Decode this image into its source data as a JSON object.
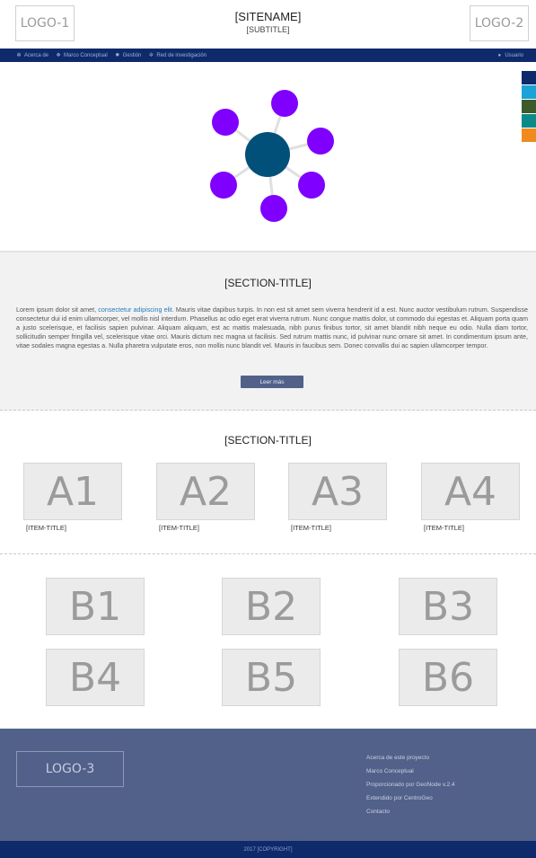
{
  "header": {
    "logo_left": "LOGO-1",
    "logo_right": "LOGO-2",
    "sitename": "[SITENAME]",
    "subtitle": "[SUBTITLE]"
  },
  "nav": {
    "items": [
      {
        "label": "Acerca de",
        "icon": "spinner-icon"
      },
      {
        "label": "Marco Conceptual",
        "icon": "cubes-icon"
      },
      {
        "label": "Gestión",
        "icon": "gear-icon"
      },
      {
        "label": "Red de investigación",
        "icon": "gears-icon"
      }
    ],
    "user": "Usuario",
    "background": "#0e2a6b"
  },
  "hero": {
    "center_color": "#00507a",
    "node_color": "#7f00ff",
    "swatches": [
      "#0e2a6b",
      "#1aa3d6",
      "#3d5a2a",
      "#0c8a8a",
      "#f08a1e"
    ]
  },
  "about": {
    "title": "[SECTION-TITLE]",
    "text_before_link": "Lorem ipsum dolor sit amet, ",
    "link": "consectetur adipiscing elit",
    "text_after_link": ". Mauris vitae dapibus turpis. In non est sit amet sem viverra hendrerit id a est. Nunc auctor vestibulum rutrum. Suspendisse consectetur dui id enim ullamcorper, vel mollis nisl interdum. Phasellus ac odio eget erat viverra rutrum. Nunc congue mattis dolor, ut commodo dui egestas et. Aliquam porta quam a justo scelerisque, et facilisis sapien pulvinar. Aliquam aliquam, est ac mattis malesuada, nibh purus finibus tortor, sit amet blandit nibh neque eu odio. Nulla diam tortor, sollicitudin semper fringilla vel, scelerisque vitae orci. Mauris dictum nec magna ut facilisis. Sed rutrum mattis nunc, id pulvinar nunc ornare sit amet. In condimentum ipsum ante, vitae sodales magna egestas a. Nulla pharetra vulputate eros, non mollis nunc blandit vel. Mauris in faucibus sem. Donec convallis dui ac sapien ullamcorper tempor.",
    "button": "Leer más"
  },
  "items_section": {
    "title": "[SECTION-TITLE]",
    "items": [
      {
        "tile": "A1",
        "title": "[ITEM-TITLE]"
      },
      {
        "tile": "A2",
        "title": "[ITEM-TITLE]"
      },
      {
        "tile": "A3",
        "title": "[ITEM-TITLE]"
      },
      {
        "tile": "A4",
        "title": "[ITEM-TITLE]"
      }
    ]
  },
  "grid_b": [
    "B1",
    "B2",
    "B3",
    "B4",
    "B5",
    "B6"
  ],
  "footer": {
    "logo": "LOGO-3",
    "links": [
      "Acerca de este proyecto",
      "Marco Conceptual",
      "Proporcionado por GeoNode v.2.4",
      "Extendido por CentroGeo",
      "Contacto"
    ],
    "copyright": "2017 [COPYRIGHT]",
    "background": "#52618a"
  }
}
